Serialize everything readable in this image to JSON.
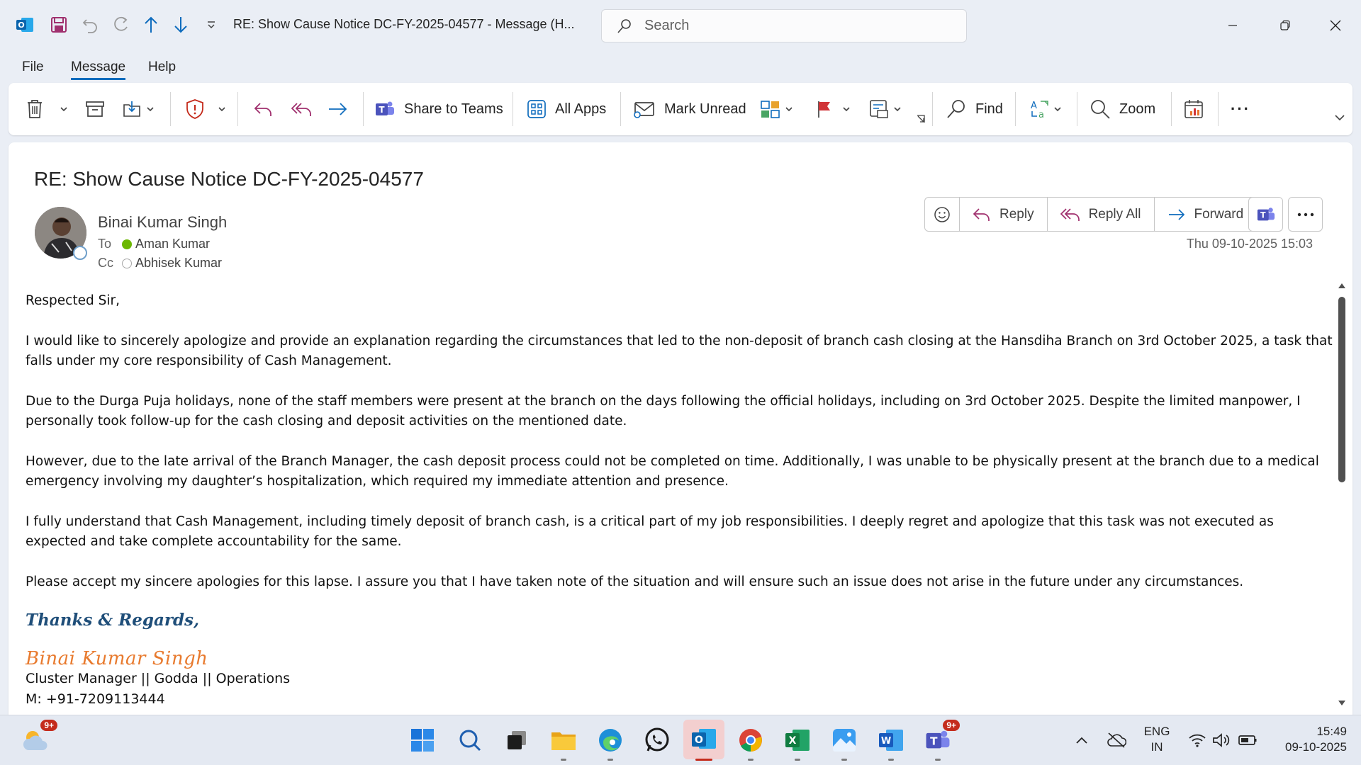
{
  "window": {
    "title": "RE: Show Cause Notice DC-FY-2025-04577  -  Message (H...",
    "search_placeholder": "Search"
  },
  "menu": [
    "File",
    "Message",
    "Help"
  ],
  "ribbon": {
    "share_to_teams": "Share to Teams",
    "all_apps": "All Apps",
    "mark_unread": "Mark Unread",
    "find": "Find",
    "zoom": "Zoom",
    "more": "···"
  },
  "message": {
    "subject": "RE: Show Cause Notice DC-FY-2025-04577",
    "sender": "Binai Kumar Singh",
    "to_label": "To",
    "to": "Aman Kumar",
    "cc_label": "Cc",
    "cc": "Abhisek Kumar",
    "datetime": "Thu 09-10-2025 15:03",
    "actions": {
      "reply": "Reply",
      "reply_all": "Reply All",
      "forward": "Forward"
    },
    "body": {
      "greeting": "Respected Sir,",
      "paragraphs": [
        "I would like to sincerely apologize and provide an explanation regarding the circumstances that led to the non-deposit of branch cash closing at the Hansdiha Branch on 3rd October 2025, a task that falls under my core responsibility of Cash Management.",
        "Due to the Durga Puja holidays, none of the staff members were present at the branch on the days following the official holidays, including on 3rd October 2025. Despite the limited manpower, I personally took follow-up for the cash closing and deposit activities on the mentioned date.",
        "However, due to the late arrival of the Branch Manager, the cash deposit process could not be completed on time. Additionally, I was unable to be physically present at the branch due to a medical emergency involving my daughter’s hospitalization, which required my immediate attention and presence.",
        "I fully understand that Cash Management, including timely deposit of branch cash, is a critical part of my job responsibilities. I deeply regret and apologize that this task was not executed as expected and take complete accountability for the same.",
        "Please accept my sincere apologies for this lapse. I assure you that I have taken note of the situation and will ensure such an issue does not arise in the future under any circumstances."
      ],
      "closing": "Thanks & Regards,",
      "signature_name": "Binai Kumar Singh",
      "signature_title": "Cluster Manager || Godda || Operations",
      "signature_phone": "M: +91-7209113444"
    }
  },
  "taskbar": {
    "weather_badge": "9+",
    "teams_badge": "9+",
    "lang_line1": "ENG",
    "lang_line2": "IN",
    "time": "15:49",
    "date": "09-10-2025"
  }
}
